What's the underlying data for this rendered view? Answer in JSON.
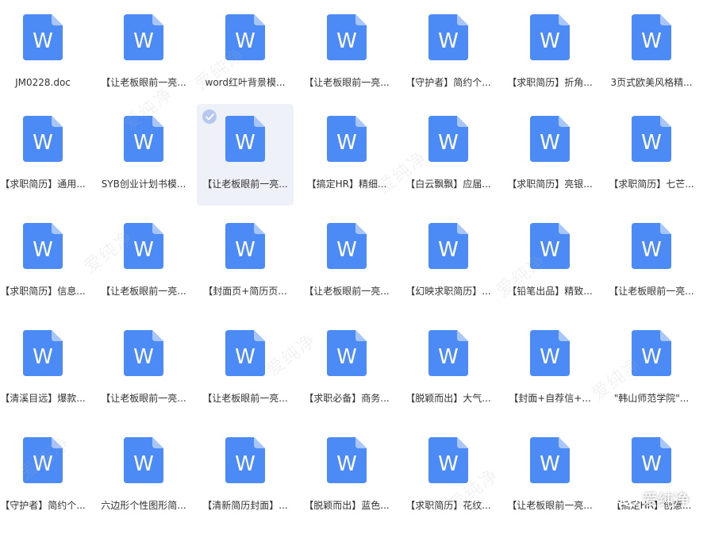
{
  "colors": {
    "icon_blue": "#4c8bf5",
    "icon_fold": "#a9c6fa",
    "selected_bg": "#eef1f7",
    "check_bg": "#b6c8ef",
    "text": "#333333"
  },
  "file_icon": {
    "name": "word-doc-icon",
    "letter": "W"
  },
  "watermark_text": "爱纯净",
  "brand": {
    "icon": "wechat-icon",
    "text": "爱纯净"
  },
  "selected_index": 9,
  "files": [
    "JM0228.doc",
    "【让老板眼前一亮...",
    "word红叶背景模...",
    "【让老板眼前一亮...",
    "【守护者】简约个...",
    "【求职简历】折角...",
    "3页式欧美风格精...",
    "【求职简历】通用...",
    "SYB创业计划书模...",
    "【让老板眼前一亮...",
    "【搞定HR】精细...",
    "【白云飘飘】应届...",
    "【求职简历】亮银...",
    "【求职简历】七芒...",
    "【求职简历】信息...",
    "【让老板眼前一亮...",
    "【封面页+简历页...",
    "【让老板眼前一亮...",
    "【幻映求职简历】...",
    "【铅笔出品】精致...",
    "【让老板眼前一亮...",
    "【清溪目远】爆款...",
    "【让老板眼前一亮...",
    "【让老板眼前一亮...",
    "【求职必备】商务...",
    "【脱颖而出】大气...",
    "【封面+自荐信+...",
    "\"韩山师范学院\"...",
    "【守护者】简约个...",
    "六边形个性图形简...",
    "【清新简历封面】...",
    "【脱颖而出】蓝色...",
    "【求职简历】花纹...",
    "【让老板眼前一亮...",
    "【搞定HR】创意..."
  ]
}
